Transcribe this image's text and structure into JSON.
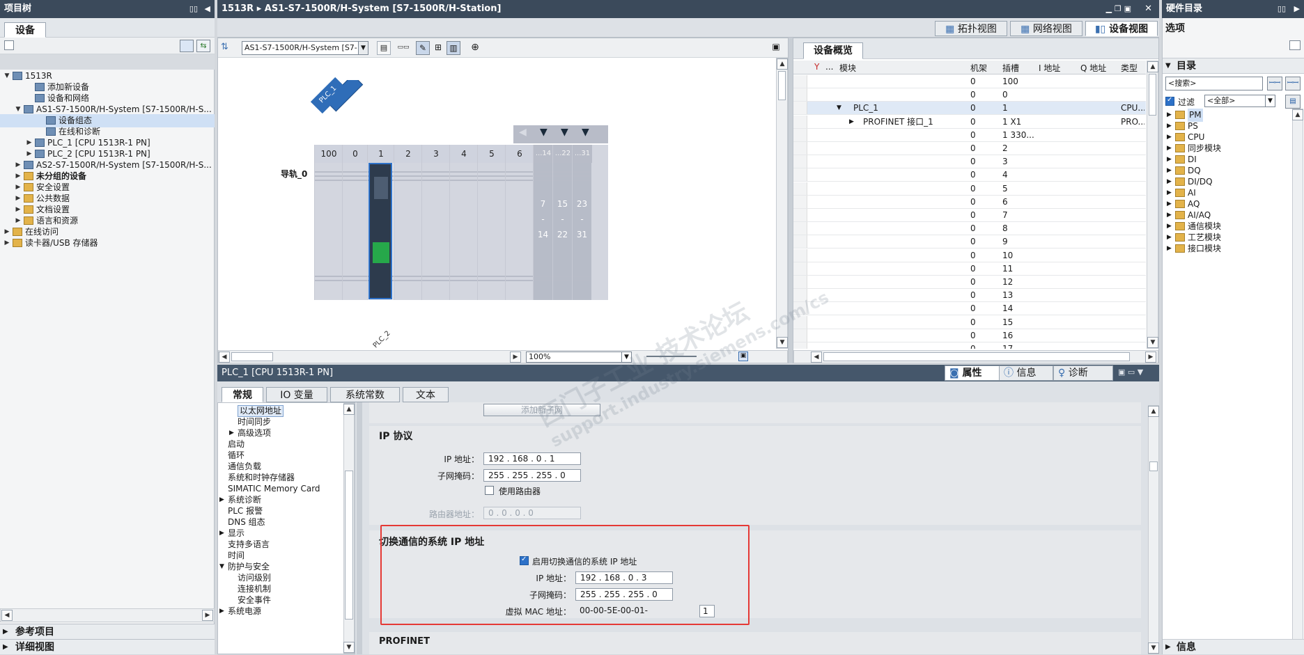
{
  "left_panel": {
    "title": "项目树",
    "tab": "设备",
    "bottom_sections": [
      "参考项目",
      "详细视图"
    ]
  },
  "tree": [
    {
      "label": "1513R",
      "indent": 0,
      "toggle": "▼",
      "icon": "project-icon"
    },
    {
      "label": "添加新设备",
      "indent": 2,
      "toggle": "",
      "icon": "add-device-icon"
    },
    {
      "label": "设备和网络",
      "indent": 2,
      "toggle": "",
      "icon": "network-icon"
    },
    {
      "label": "AS1-S7-1500R/H-System [S7-1500R/H-S...",
      "indent": 1,
      "toggle": "▼",
      "icon": "system-icon"
    },
    {
      "label": "设备组态",
      "indent": 3,
      "toggle": "",
      "icon": "device-config-icon",
      "selected": true
    },
    {
      "label": "在线和诊断",
      "indent": 3,
      "toggle": "",
      "icon": "diagnostics-icon"
    },
    {
      "label": "PLC_1 [CPU 1513R-1 PN]",
      "indent": 2,
      "toggle": "▶",
      "icon": "plc-icon"
    },
    {
      "label": "PLC_2 [CPU 1513R-1 PN]",
      "indent": 2,
      "toggle": "▶",
      "icon": "plc-icon"
    },
    {
      "label": "AS2-S7-1500R/H-System [S7-1500R/H-S...",
      "indent": 1,
      "toggle": "▶",
      "icon": "system-icon"
    },
    {
      "label": "未分组的设备",
      "indent": 1,
      "toggle": "▶",
      "icon": "folder-icon",
      "bold": true
    },
    {
      "label": "安全设置",
      "indent": 1,
      "toggle": "▶",
      "icon": "folder-icon"
    },
    {
      "label": "公共数据",
      "indent": 1,
      "toggle": "▶",
      "icon": "folder-icon"
    },
    {
      "label": "文档设置",
      "indent": 1,
      "toggle": "▶",
      "icon": "folder-icon"
    },
    {
      "label": "语言和资源",
      "indent": 1,
      "toggle": "▶",
      "icon": "folder-icon"
    },
    {
      "label": "在线访问",
      "indent": 0,
      "toggle": "▶",
      "icon": "folder-icon"
    },
    {
      "label": "读卡器/USB 存储器",
      "indent": 0,
      "toggle": "▶",
      "icon": "folder-icon"
    }
  ],
  "editor": {
    "title": "1513R  ▸  AS1-S7-1500R/H-System [S7-1500R/H-Station]",
    "view_tabs": [
      "拓扑视图",
      "网络视图",
      "设备视图"
    ],
    "device_select": "AS1-S7-1500R/H-System [S7-1",
    "zoom": "100%",
    "rail_label": "导轨_0",
    "plc1_tag": "PLC_1",
    "plc2_tag": "PLC_2",
    "slots": [
      "100",
      "0",
      "1",
      "2",
      "3",
      "4",
      "5",
      "6",
      "...14",
      "...22",
      "...31"
    ],
    "rack_ranges": [
      [
        "7",
        "-",
        "14"
      ],
      [
        "15",
        "-",
        "22"
      ],
      [
        "23",
        "-",
        "31"
      ]
    ]
  },
  "overview": {
    "tab": "设备概览",
    "columns": [
      "...",
      "模块",
      "机架",
      "插槽",
      "I 地址",
      "Q 地址",
      "类型"
    ],
    "rows": [
      {
        "module": "",
        "rack": "0",
        "slot": "100",
        "type": ""
      },
      {
        "module": "",
        "rack": "0",
        "slot": "0",
        "type": ""
      },
      {
        "module": "PLC_1",
        "rack": "0",
        "slot": "1",
        "type": "CPU...",
        "toggle": "▼",
        "selected": true
      },
      {
        "module": "PROFINET 接口_1",
        "rack": "0",
        "slot": "1 X1",
        "type": "PRO...",
        "toggle": "▶",
        "sub": true
      },
      {
        "module": "",
        "rack": "0",
        "slot": "1 330...",
        "type": ""
      },
      {
        "module": "",
        "rack": "0",
        "slot": "2",
        "type": ""
      },
      {
        "module": "",
        "rack": "0",
        "slot": "3",
        "type": ""
      },
      {
        "module": "",
        "rack": "0",
        "slot": "4",
        "type": ""
      },
      {
        "module": "",
        "rack": "0",
        "slot": "5",
        "type": ""
      },
      {
        "module": "",
        "rack": "0",
        "slot": "6",
        "type": ""
      },
      {
        "module": "",
        "rack": "0",
        "slot": "7",
        "type": ""
      },
      {
        "module": "",
        "rack": "0",
        "slot": "8",
        "type": ""
      },
      {
        "module": "",
        "rack": "0",
        "slot": "9",
        "type": ""
      },
      {
        "module": "",
        "rack": "0",
        "slot": "10",
        "type": ""
      },
      {
        "module": "",
        "rack": "0",
        "slot": "11",
        "type": ""
      },
      {
        "module": "",
        "rack": "0",
        "slot": "12",
        "type": ""
      },
      {
        "module": "",
        "rack": "0",
        "slot": "13",
        "type": ""
      },
      {
        "module": "",
        "rack": "0",
        "slot": "14",
        "type": ""
      },
      {
        "module": "",
        "rack": "0",
        "slot": "15",
        "type": ""
      },
      {
        "module": "",
        "rack": "0",
        "slot": "16",
        "type": ""
      },
      {
        "module": "",
        "rack": "0",
        "slot": "17",
        "type": ""
      }
    ]
  },
  "inspector": {
    "title": "PLC_1 [CPU 1513R-1 PN]",
    "right_tabs": [
      "属性",
      "信息",
      "诊断"
    ],
    "tabs": [
      "常规",
      "IO 变量",
      "系统常数",
      "文本"
    ],
    "nav": [
      {
        "label": "以太网地址",
        "indent": 2,
        "selected": true
      },
      {
        "label": "时间同步",
        "indent": 2
      },
      {
        "label": "高级选项",
        "indent": 2,
        "toggle": "▶"
      },
      {
        "label": "启动",
        "indent": 1
      },
      {
        "label": "循环",
        "indent": 1
      },
      {
        "label": "通信负载",
        "indent": 1
      },
      {
        "label": "系统和时钟存储器",
        "indent": 1
      },
      {
        "label": "SIMATIC Memory Card",
        "indent": 1
      },
      {
        "label": "系统诊断",
        "indent": 1,
        "toggle": "▶"
      },
      {
        "label": "PLC 报警",
        "indent": 1
      },
      {
        "label": "DNS 组态",
        "indent": 1
      },
      {
        "label": "显示",
        "indent": 1,
        "toggle": "▶"
      },
      {
        "label": "支持多语言",
        "indent": 1
      },
      {
        "label": "时间",
        "indent": 1
      },
      {
        "label": "防护与安全",
        "indent": 1,
        "toggle": "▼"
      },
      {
        "label": "访问级别",
        "indent": 2
      },
      {
        "label": "连接机制",
        "indent": 2
      },
      {
        "label": "安全事件",
        "indent": 2
      },
      {
        "label": "系统电源",
        "indent": 1,
        "toggle": "▶"
      }
    ],
    "add_subnet": "添加新子网",
    "ip_protocol": {
      "heading": "IP 协议",
      "ip_label": "IP 地址：",
      "ip": [
        "192",
        "168",
        "0",
        "1"
      ],
      "mask_label": "子网掩码：",
      "mask": [
        "255",
        "255",
        "255",
        "0"
      ],
      "use_router": "使用路由器",
      "router_label": "路由器地址：",
      "router": [
        "0",
        "0",
        "0",
        "0"
      ]
    },
    "switch_section": {
      "heading": "切换通信的系统 IP 地址",
      "enable_label": "启用切换通信的系统 IP 地址",
      "ip_label": "IP 地址：",
      "ip": [
        "192",
        "168",
        "0",
        "3"
      ],
      "mask_label": "子网掩码：",
      "mask": [
        "255",
        "255",
        "255",
        "0"
      ],
      "mac_label": "虚拟 MAC 地址：",
      "mac_prefix": "00-00-5E-00-01-",
      "mac_value": "1"
    },
    "profinet_heading": "PROFINET"
  },
  "catalog": {
    "title": "硬件目录",
    "options": "选项",
    "directory": "目录",
    "search_placeholder": "<搜索>",
    "filter_label": "过滤",
    "filter_value": "<全部>",
    "items": [
      "PM",
      "PS",
      "CPU",
      "同步模块",
      "DI",
      "DQ",
      "DI/DQ",
      "AI",
      "AQ",
      "AI/AQ",
      "通信模块",
      "工艺模块",
      "接口模块"
    ],
    "info": "信息"
  },
  "watermark": {
    "line1": "西门子工业  技术论坛",
    "line2": "support.industry.siemens.com/cs"
  },
  "colors": {
    "title_bar": "#3b4a5b",
    "highlight": "#e53935",
    "accent": "#2d71c8",
    "rack": "#cfd3de"
  }
}
